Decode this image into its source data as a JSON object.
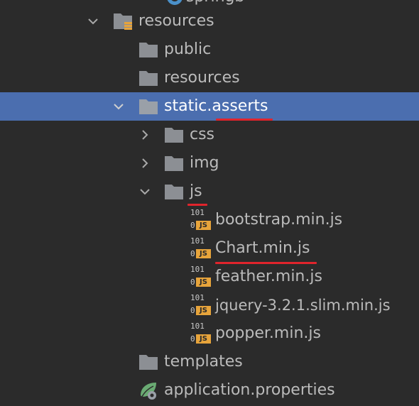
{
  "tree": {
    "partial_top_label": "springb",
    "resources_root": {
      "label": "resources",
      "expanded": true
    },
    "public": {
      "label": "public"
    },
    "resources_sub": {
      "label": "resources"
    },
    "static": {
      "label": "static.asserts",
      "expanded": true,
      "selected": true
    },
    "css": {
      "label": "css",
      "expanded": false
    },
    "img": {
      "label": "img",
      "expanded": false
    },
    "js": {
      "label": "js",
      "expanded": true
    },
    "files": [
      {
        "label": "bootstrap.min.js",
        "badge": "JS",
        "bin_top": "101",
        "bin_bottom": "0"
      },
      {
        "label": "Chart.min.js",
        "badge": "JS",
        "bin_top": "101",
        "bin_bottom": "0"
      },
      {
        "label": "feather.min.js",
        "badge": "JS",
        "bin_top": "101",
        "bin_bottom": "0"
      },
      {
        "label": "jquery-3.2.1.slim.min.js",
        "badge": "JS",
        "bin_top": "101",
        "bin_bottom": "0"
      },
      {
        "label": "popper.min.js",
        "badge": "JS",
        "bin_top": "101",
        "bin_bottom": "0"
      }
    ],
    "templates": {
      "label": "templates"
    },
    "app_props": {
      "label": "application.properties"
    }
  },
  "colors": {
    "background": "#2b2b2b",
    "selection": "#4b6eaf",
    "text": "#bbbbbb",
    "folder": "#8c8f94",
    "annotation_underline": "#e0242c",
    "js_badge": "#e7a43b",
    "spring_leaf": "#6aab73"
  },
  "icons": {
    "expanded": "chevron-down-icon",
    "collapsed": "chevron-right-icon",
    "folder": "folder-icon",
    "resources_root": "resources-folder-icon",
    "js_file": "js-file-icon",
    "properties": "spring-properties-icon"
  }
}
